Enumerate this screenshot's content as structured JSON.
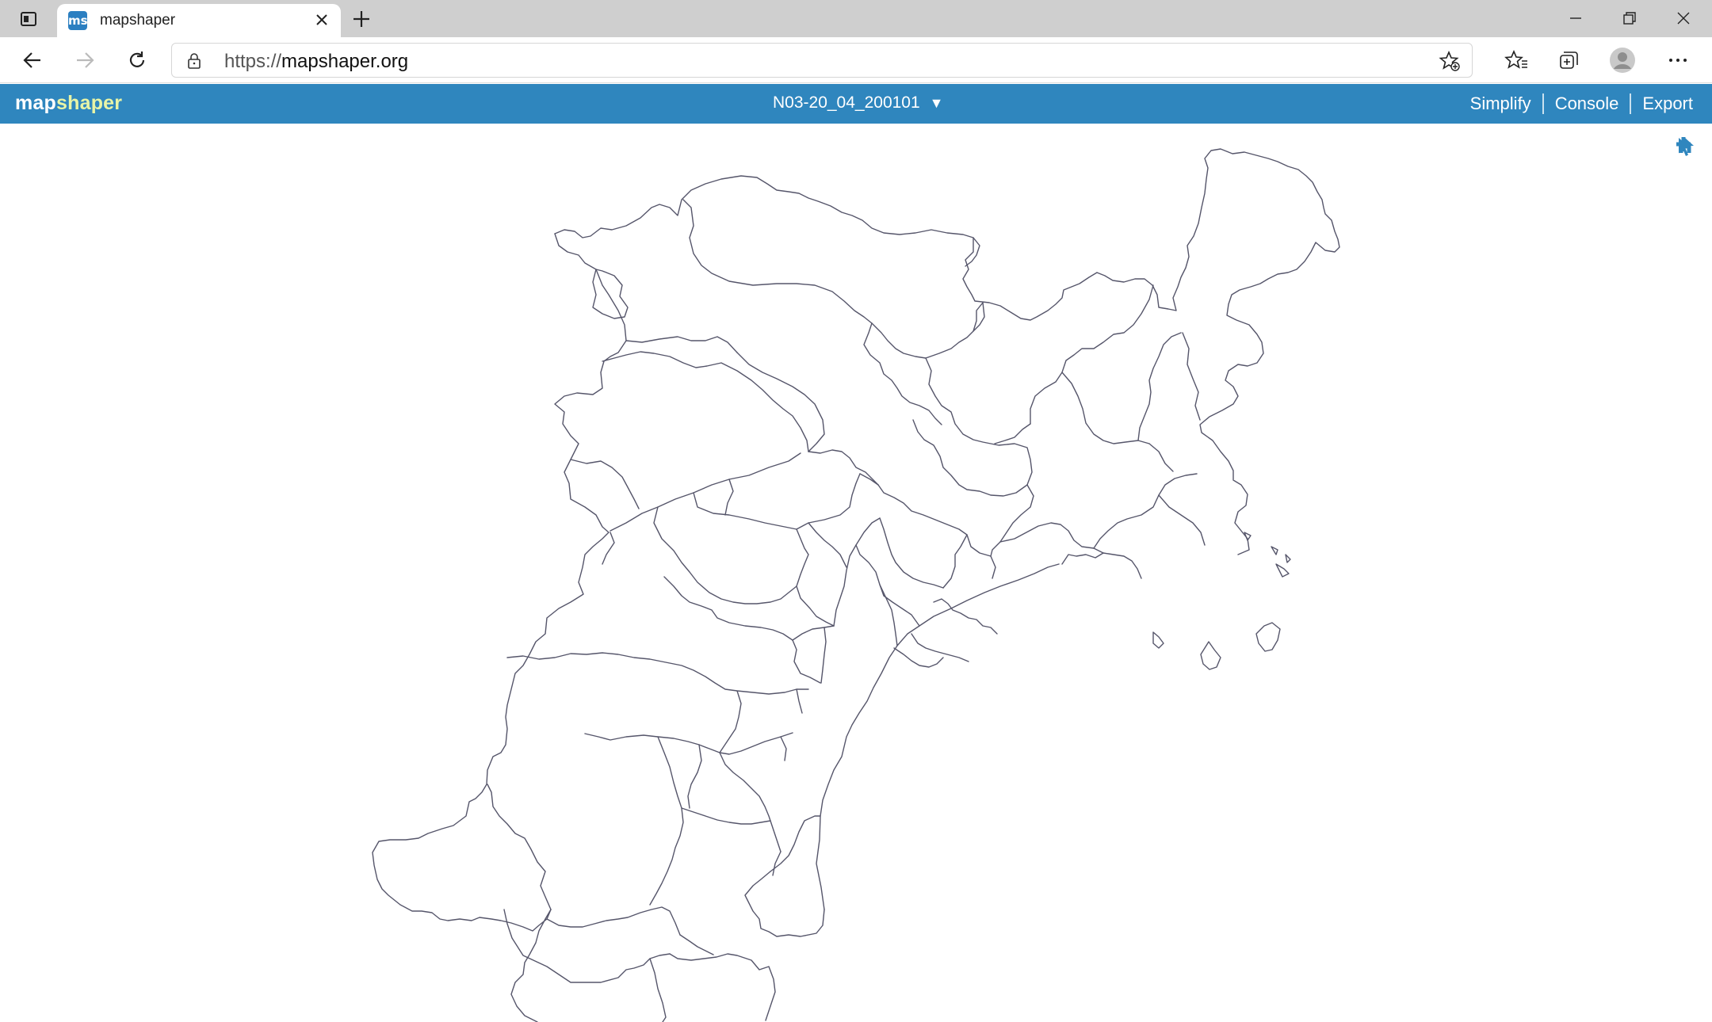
{
  "browser": {
    "tab_title": "mapshaper",
    "favicon_text": "ms",
    "url_prefix": "https://",
    "url_host": "mapshaper.org"
  },
  "app": {
    "logo_part1": "map",
    "logo_part2": "shaper",
    "layer_name": "N03-20_04_200101",
    "layer_arrow": "▼",
    "menu": {
      "simplify": "Simplify",
      "console": "Console",
      "export": "Export"
    }
  },
  "map_tools": [
    "home-icon",
    "zoom-in-icon",
    "zoom-out-icon",
    "pointer-select-icon"
  ],
  "colors": {
    "accent": "#2f86be",
    "logo_highlight": "#e8f4a6",
    "tool_icon": "#2f86be",
    "map_outline": "#5a5a6e"
  }
}
